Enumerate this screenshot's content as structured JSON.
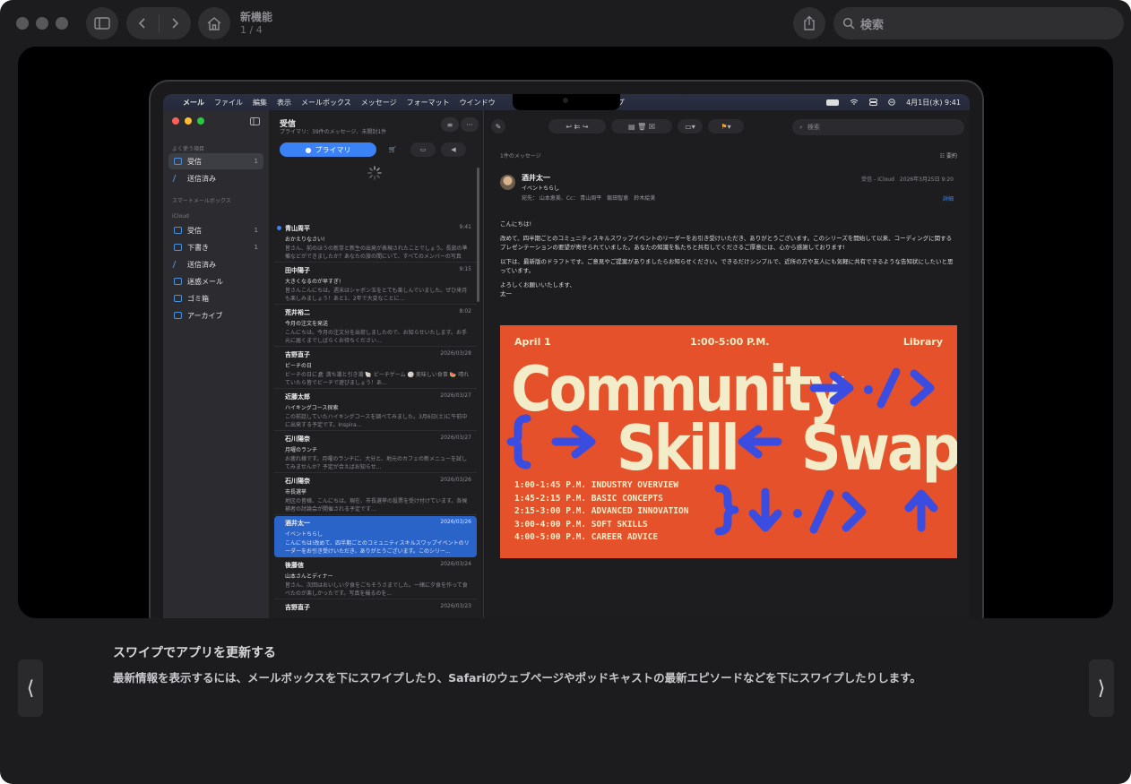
{
  "window": {
    "title": "新機能",
    "page_indicator": "1 / 4",
    "search_placeholder": "検索"
  },
  "menubar": {
    "items": [
      "メール",
      "ファイル",
      "編集",
      "表示",
      "メールボックス",
      "メッセージ",
      "フォーマット",
      "ウインドウ",
      "ヘルプ"
    ],
    "clock": "4月1日(水) 9:41"
  },
  "sidebar": {
    "favorites_header": "よく使う項目",
    "smart_header": "スマートメールボックス",
    "icloud_header": "iCloud",
    "favorites": [
      {
        "label": "受信",
        "count": "1"
      },
      {
        "label": "送信済み",
        "count": ""
      }
    ],
    "icloud": [
      {
        "label": "受信",
        "count": "1"
      },
      {
        "label": "下書き",
        "count": "1"
      },
      {
        "label": "送信済み",
        "count": ""
      },
      {
        "label": "迷惑メール",
        "count": ""
      },
      {
        "label": "ゴミ箱",
        "count": ""
      },
      {
        "label": "アーカイブ",
        "count": ""
      }
    ]
  },
  "message_list": {
    "title": "受信",
    "subtitle": "プライマリ：39件のメッセージ、未開封1件",
    "primary_tab": "プライマリ",
    "messages": [
      {
        "from": "青山周平",
        "date": "9:41",
        "subject": "おかえりなさい!",
        "preview": "皆さん、前のほうの新芽と新生の出発が表現されたことでしょう。長旅の準備などができましたか？あなたの旅の間にいて、すべてのメンバーの写真を..."
      },
      {
        "from": "田中陽子",
        "date": "9:15",
        "subject": "大きくなるのが早すぎ!",
        "preview": "皆さんこんにちは。週末はシャボン玉をとても楽しんでいました。ぜひ来月も楽しみましょう！あと1、2年で大変なことに..."
      },
      {
        "from": "荒井裕二",
        "date": "8:02",
        "subject": "今月の注文を発送",
        "preview": "こんにちは。今月の注文分を出荷しましたので、お知らせいたします。お手元に届くまでしばらくお待ちください..."
      },
      {
        "from": "吉野直子",
        "date": "2026/03/28",
        "subject": "ビーチの日",
        "preview": "ビーチの日に🏖 満ち潮と引き潮 🐚 ビーチゲーム 🏐 美味しい食事 🍉 晴れていたら皆でビーチで遊びましょう！あ..."
      },
      {
        "from": "近藤太郎",
        "date": "2026/03/27",
        "subject": "ハイキングコース探索",
        "preview": "この前話していたハイキングコースを調べてみました。3月6日(土)に午前中に出発する予定です。Inspira..."
      },
      {
        "from": "石川陽奈",
        "date": "2026/03/27",
        "subject": "月曜のランチ",
        "preview": "お疲れ様です。月曜のランチに、大分と、地元のカフェの新メニューを試してみませんか？予定が合えばお知らせ..."
      },
      {
        "from": "石川陽奈",
        "date": "2026/03/26",
        "subject": "市長選挙",
        "preview": "地区の皆様、こんにちは。現在、市長選挙の投票を受け付けています。各候補者の討論会が開催される予定です..."
      },
      {
        "from": "酒井太一",
        "date": "2026/03/26",
        "subject": "イベントちらし",
        "preview": "こんにちは!改めて、四半期ごとのコミュニティスキルスワップイベントのリーダーをお引き受けいただき、ありがとうございます。このシリー..."
      },
      {
        "from": "後藤信",
        "date": "2026/03/24",
        "subject": "山本さんとディナー",
        "preview": "皆さん、次回はおいしい夕食をごちそうさまでした。一緒に夕食を作って食べたのが楽しかったです。写真を撮るのを..."
      },
      {
        "from": "吉野直子",
        "date": "2026/03/23",
        "subject": "",
        "preview": ""
      }
    ]
  },
  "reader": {
    "search_placeholder": "検索",
    "count": "1件のメッセージ",
    "summarize": "要約",
    "from": "酒井太一",
    "subject": "イベントちらし",
    "to": "宛先： 山本恵美、Cc： 青山周平　飯田智恵　鈴木絵美",
    "meta": "受信 - iCloud　2026年3月25日 9:20",
    "details": "詳細",
    "body": [
      "こんにちは!",
      "改めて、四半期ごとのコミュニティスキルスワップイベントのリーダーをお引き受けいただき、ありがとうございます。このシリーズを開始して以来、コーディングに関するプレゼンテーションの要望が寄せられていました。あなたの知識を私たちと共有してくださるご厚意には、心から感謝しております!",
      "以下は、最新版のドラフトです。ご意見やご提案がありましたらお知らせください。できるだけシンプルで、近所の方や友人にも気軽に共有できるような告知状にしたいと思っています。",
      "よろしくお願いいたします、\n太一"
    ],
    "poster": {
      "date": "April 1",
      "time": "1:00-5:00 P.M.",
      "place": "Library",
      "line1": "Community",
      "line2a": "Skill",
      "line2b": "Swap",
      "schedule": [
        "1:00-1:45 P.M. INDUSTRY OVERVIEW",
        "1:45-2:15 P.M. BASIC CONCEPTS",
        "2:15-3:00 P.M. ADVANCED INNOVATION",
        "3:00-4:00 P.M. SOFT SKILLS",
        "4:00-5:00 P.M. CAREER ADVICE"
      ],
      "colors": {
        "background": "#e4512b",
        "text": "#f3ecc9",
        "glyph": "#3b4de0"
      }
    }
  },
  "caption": {
    "title": "スワイプでアプリを更新する",
    "description": "最新情報を表示するには、メールボックスを下にスワイプしたり、Safariのウェブページやポッドキャストの最新エピソードなどを下にスワイプしたりします。"
  },
  "colors": {
    "window_bg": "#1c1c1e",
    "accent": "#3b82f6",
    "selection": "#2a64c9"
  }
}
